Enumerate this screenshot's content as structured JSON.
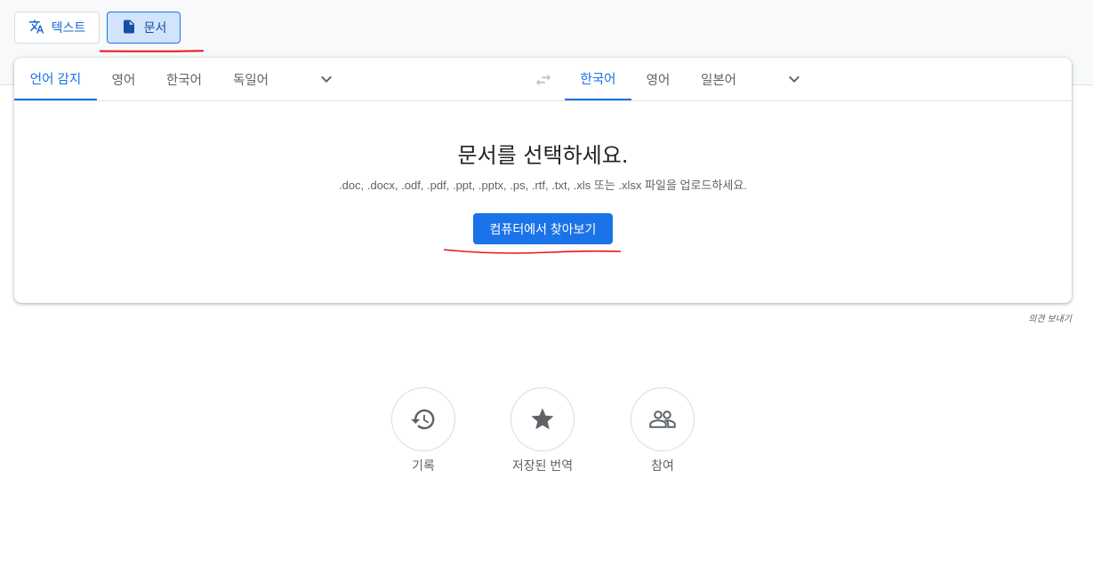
{
  "modes": {
    "text_label": "텍스트",
    "document_label": "문서",
    "text_icon": "translate-icon",
    "document_icon": "document-icon"
  },
  "source_langs": [
    "언어 감지",
    "영어",
    "한국어",
    "독일어"
  ],
  "target_langs": [
    "한국어",
    "영어",
    "일본어"
  ],
  "main": {
    "title": "문서를 선택하세요.",
    "description": ".doc, .docx, .odf, .pdf, .ppt, .pptx, .ps, .rtf, .txt, .xls 또는 .xlsx 파일을 업로드하세요.",
    "browse_label": "컴퓨터에서 찾아보기"
  },
  "feedback_label": "의견 보내기",
  "quick_actions": [
    {
      "label": "기록",
      "icon": "history-icon"
    },
    {
      "label": "저장된 번역",
      "icon": "star-icon"
    },
    {
      "label": "참여",
      "icon": "people-icon"
    }
  ],
  "colors": {
    "accent": "#1a73e8",
    "annotation_red": "#e8141a"
  }
}
